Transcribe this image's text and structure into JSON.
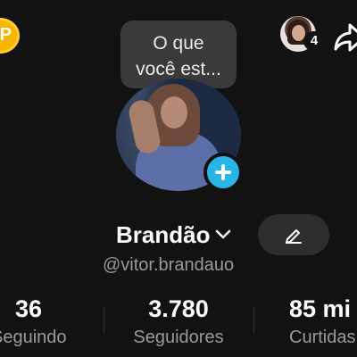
{
  "header": {
    "coin_label": "P",
    "friend_count": "4",
    "icons": {
      "coin": "coin-icon",
      "friend_avatar": "avatar",
      "share": "share-icon"
    }
  },
  "note_bubble": {
    "line1": "O que",
    "line2": "você est..."
  },
  "profile": {
    "display_name": "Brandão",
    "username": "@vitor.brandauo",
    "add_avatar_icon": "plus-icon",
    "edit_icon": "pencil-icon"
  },
  "stats": [
    {
      "value": "36",
      "label": "Seguindo"
    },
    {
      "value": "3.780",
      "label": "Seguidores"
    },
    {
      "value": "85 mi",
      "label": "Curtidas"
    }
  ],
  "colors": {
    "background": "#121212",
    "accent": "#29b6e6",
    "coin": "#f7b500",
    "muted_text": "#9a9a9a"
  }
}
